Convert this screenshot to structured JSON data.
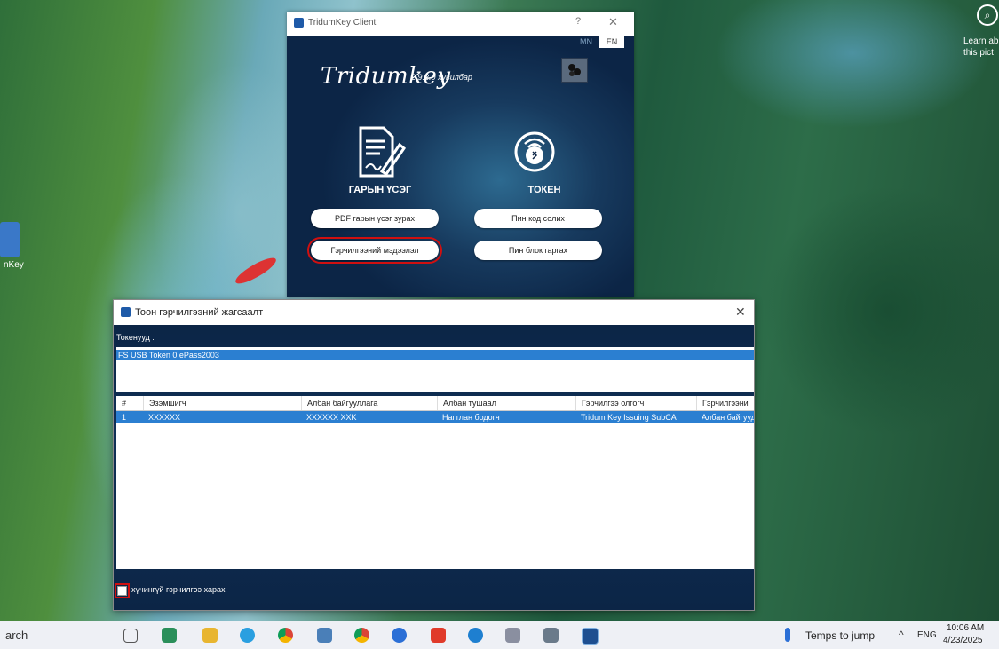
{
  "desktop": {
    "icon_label": "nKey",
    "learn_text": "Learn ab this pict"
  },
  "tridumkey": {
    "window_title": "TridumKey Client",
    "help": "?",
    "close": "✕",
    "lang_mn": "MN",
    "lang_en": "EN",
    "brand": "Tridumkey",
    "version": "2.9.2.0 хувилбар",
    "signature": {
      "heading": "ГАРЫН ҮСЭГ",
      "btn_pdf": "PDF гарын үсэг зурах",
      "btn_cert_info": "Гэрчилгээний мэдээлэл"
    },
    "token": {
      "heading": "ТОКЕН",
      "btn_change_pin": "Пин код солих",
      "btn_unblock_pin": "Пин блок гаргах"
    }
  },
  "cert_dialog": {
    "title": "Тоон гэрчилгээний жагсаалт",
    "close": "✕",
    "tokens_label": "Токенууд :",
    "tokens": [
      "FS USB Token 0 ePass2003"
    ],
    "columns": [
      "#",
      "Эзэмшигч",
      "Албан байгууллага",
      "Албан тушаал",
      "Гэрчилгээ олгогч",
      "Гэрчилгээни"
    ],
    "rows": [
      [
        "1",
        "XXXXXX",
        "XXXXXX  XXK",
        "Нагтлан бодогч",
        "Tridum Key Issuing SubCA",
        "Албан байгууд"
      ]
    ],
    "checkbox_label": "хүчингүй гэрчилгээ харах",
    "checkbox_checked": false
  },
  "taskbar": {
    "search_text": "arch",
    "weather": "Temps to jump",
    "caret": "^",
    "language": "ENG",
    "time": "10:06 AM",
    "date": "4/23/2025",
    "icons": [
      "task-view-icon",
      "app-icon",
      "file-explorer-icon",
      "telegram-icon",
      "chrome-icon",
      "notepad-icon",
      "chrome-alt-icon",
      "app-blue-icon",
      "anydesk-icon",
      "edge-icon",
      "paint-icon",
      "folder-icon",
      "tridumkey-icon"
    ]
  }
}
